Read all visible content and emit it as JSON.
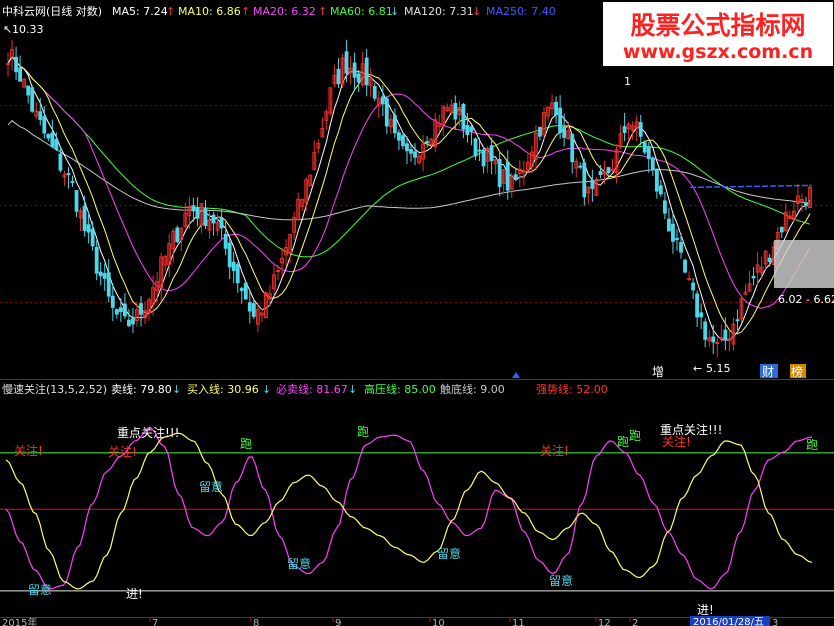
{
  "colors": {
    "bg": "#000000",
    "up": "#e8302c",
    "down": "#4fd6e8",
    "ma5": "#ffffff",
    "ma10": "#ffff66",
    "ma20": "#ff40ff",
    "ma60": "#40ff40",
    "ma120": "#c8c8c8",
    "ma250": "#3a5cff",
    "grid": "#8b0000",
    "divider": "#b01010",
    "watermark": "#ff2020"
  },
  "header": {
    "title": "中科云网(日线 对数)",
    "ma5_label": "MA5: 7.24",
    "ma10_label": "MA10: 6.86",
    "ma20_label": "MA20: 6.32",
    "ma60_label": "MA60: 6.81",
    "ma120_label": "MA120: 7.31",
    "ma250_label": "MA250: 7.40",
    "ma5_arrow": "↑",
    "ma10_arrow": "↑",
    "ma20_arrow": "↑",
    "ma60_arrow": "↓",
    "ma120_arrow": "↓"
  },
  "watermark": {
    "line1": "股票公式指标网",
    "line2": "www.gszx.com.cn"
  },
  "price_annotations": {
    "high_label": "10.33",
    "peak_marker": "1",
    "low_label": "5.15",
    "range_label": "6.02 - 6.62",
    "tag_zeng": "增",
    "tag_caicai": "财",
    "tag_bang": "榜"
  },
  "indicator_header": {
    "name": "慢速关注(13,5,2,52)",
    "sell_label": "卖线: 79.80",
    "sell_arrow": "↓",
    "buy_label": "买入线: 30.96",
    "buy_arrow": "↓",
    "must_sell_label": "必卖线: 81.67",
    "must_sell_arrow": "↓",
    "high_line_label": "高压线: 85.00",
    "bottom_line_label": "触底线: 9.00",
    "strong_label": "强势线: 52.00"
  },
  "indicator_annotations": [
    {
      "text": "关注!",
      "kind": "guanzhu"
    },
    {
      "text": "关注!",
      "kind": "guanzhu"
    },
    {
      "text": "关注!",
      "kind": "guanzhu"
    },
    {
      "text": "关注!",
      "kind": "guanzhu"
    },
    {
      "text": "重点关注!!!",
      "kind": "zhongdian"
    },
    {
      "text": "重点关注!!!",
      "kind": "zhongdian"
    },
    {
      "text": "跑",
      "kind": "pao"
    },
    {
      "text": "跑",
      "kind": "pao"
    },
    {
      "text": "跑",
      "kind": "pao"
    },
    {
      "text": "跑",
      "kind": "pao"
    },
    {
      "text": "跑",
      "kind": "pao"
    },
    {
      "text": "留意",
      "kind": "liuyi"
    },
    {
      "text": "留意",
      "kind": "liuyi"
    },
    {
      "text": "留意",
      "kind": "liuyi"
    },
    {
      "text": "留意",
      "kind": "liuyi"
    },
    {
      "text": "留意",
      "kind": "liuyi"
    },
    {
      "text": "进!",
      "kind": "jin"
    },
    {
      "text": "进!",
      "kind": "jin"
    }
  ],
  "date_axis": {
    "start_label": "2015年",
    "ticks": [
      "7",
      "8",
      "9",
      "10",
      "11",
      "12",
      "2",
      "3"
    ],
    "cursor_label": "2016/01/28/五"
  },
  "chart_data": [
    {
      "type": "candlestick",
      "title": "中科云网(日线 对数)",
      "series_names": [
        "MA5",
        "MA10",
        "MA20",
        "MA60",
        "MA120",
        "MA250"
      ],
      "ma_last_values": {
        "MA5": 7.24,
        "MA10": 6.86,
        "MA20": 6.32,
        "MA60": 6.81,
        "MA120": 7.31,
        "MA250": 7.4
      },
      "ylim": [
        5.0,
        10.6
      ],
      "log_scale": true,
      "marked_high": 10.33,
      "marked_low": 5.15,
      "anchor_closes": [
        9.9,
        9.4,
        8.7,
        8.2,
        7.8,
        7.4,
        6.7,
        6.2,
        5.7,
        5.5,
        5.6,
        5.9,
        6.3,
        6.7,
        7.1,
        7.0,
        6.9,
        6.4,
        6.0,
        5.6,
        5.8,
        6.2,
        6.8,
        7.4,
        8.2,
        9.1,
        9.7,
        9.5,
        9.3,
        8.8,
        8.1,
        7.8,
        8.2,
        8.5,
        8.8,
        8.6,
        8.1,
        7.9,
        7.6,
        7.4,
        7.8,
        8.4,
        8.8,
        8.4,
        7.7,
        7.2,
        7.5,
        7.9,
        8.6,
        8.2,
        7.5,
        6.9,
        6.3,
        5.8,
        5.4,
        5.2,
        5.5,
        5.9,
        6.2,
        6.5,
        6.9,
        7.2,
        7.3
      ],
      "grid": true
    },
    {
      "type": "line",
      "title": "慢速关注(13,5,2,52)",
      "ylim": [
        0,
        100
      ],
      "hlines": {
        "卖线": 79.8,
        "买入线": 30.96,
        "必卖线": 81.67,
        "高压线": 85.0,
        "触底线": 9.0,
        "强势线": 52.0
      },
      "series": [
        {
          "name": "慢速关注",
          "color": "#ff40ff",
          "anchors": [
            52,
            35,
            20,
            10,
            12,
            32,
            55,
            72,
            80,
            88,
            95,
            85,
            60,
            42,
            38,
            45,
            66,
            80,
            62,
            38,
            22,
            18,
            24,
            42,
            68,
            86,
            90,
            91,
            88,
            72,
            55,
            45,
            38,
            42,
            62,
            58,
            40,
            25,
            18,
            28,
            55,
            80,
            88,
            82,
            70,
            55,
            40,
            28,
            15,
            10,
            18,
            40,
            62,
            78,
            82,
            88,
            90
          ]
        },
        {
          "name": "",
          "color": "#ffff66",
          "anchors": [
            78,
            66,
            50,
            30,
            14,
            10,
            14,
            28,
            50,
            68,
            82,
            90,
            92,
            88,
            76,
            60,
            44,
            38,
            45,
            56,
            66,
            70,
            64,
            56,
            48,
            42,
            38,
            32,
            28,
            24,
            30,
            46,
            62,
            72,
            66,
            58,
            50,
            40,
            36,
            42,
            50,
            44,
            30,
            20,
            16,
            22,
            40,
            58,
            70,
            80,
            88,
            86,
            70,
            50,
            36,
            28,
            24
          ]
        }
      ]
    }
  ]
}
